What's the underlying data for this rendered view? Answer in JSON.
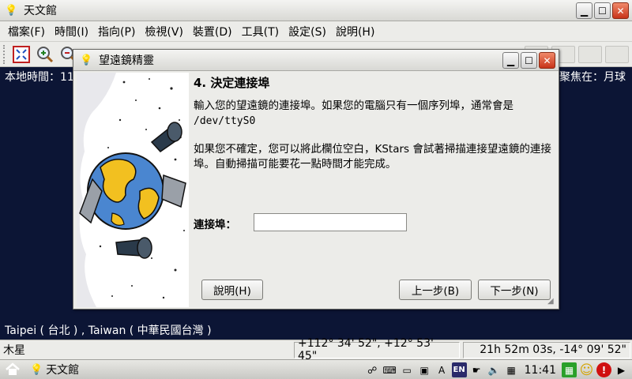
{
  "main_window": {
    "title": "天文館"
  },
  "menubar": {
    "items": [
      "檔案(F)",
      "時間(I)",
      "指向(P)",
      "檢視(V)",
      "裝置(D)",
      "工具(T)",
      "設定(S)",
      "說明(H)"
    ]
  },
  "sky": {
    "local_time_label": "本地時間：11",
    "focus_label": "聚焦在：月球",
    "location": "Taipei ( 台北 ) , Taiwan ( 中華民國台灣 )"
  },
  "statusbar": {
    "object": "木星",
    "horizontal_coords": "+112° 34' 52\", +12° 53' 45\"",
    "equatorial_coords": "21h 52m 03s, -14° 09' 52\""
  },
  "taskbar": {
    "task_label": "天文館",
    "clock": "11:41",
    "lang": "EN"
  },
  "dialog": {
    "title": "望遠鏡精靈",
    "step_title": "4. 決定連接埠",
    "para1_text": "輸入您的望遠鏡的連接埠。如果您的電腦只有一個序列埠，通常會是",
    "para1_device": "/dev/ttyS0",
    "para2": "如果您不確定，您可以將此欄位空白，KStars 會試著掃描連接望遠鏡的連接埠。自動掃描可能要花一點時間才能完成。",
    "port_label": "連接埠：",
    "port_value": "",
    "help_button": "說明(H)",
    "back_button": "上一步(B)",
    "next_button": "下一步(N)"
  },
  "colors": {
    "sky_background": "#0c1535",
    "window_background": "#ecece9",
    "close_button": "#c8341a"
  },
  "icons": {
    "app": "telescope-app-icon",
    "toolbar": [
      "zoom-fit-icon",
      "zoom-in-icon",
      "zoom-out-icon"
    ],
    "tray": [
      "network-icon",
      "keyboard-icon",
      "battery-icon",
      "media-icon",
      "input-method-icon",
      "language-icon",
      "hand-icon",
      "volume-icon",
      "calendar-icon",
      "green-grid-icon",
      "smiley-icon",
      "power-icon",
      "arrow-right-icon"
    ]
  }
}
